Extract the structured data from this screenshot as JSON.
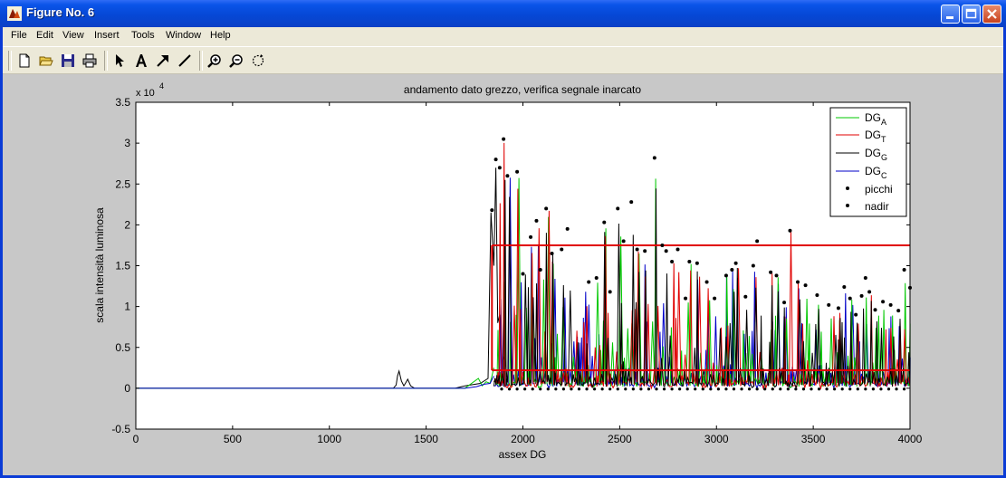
{
  "window": {
    "title": "Figure No. 6"
  },
  "menu": [
    "File",
    "Edit",
    "View",
    "Insert",
    "Tools",
    "Window",
    "Help"
  ],
  "toolbar": {
    "icons": [
      "new-file-icon",
      "open-folder-icon",
      "save-icon",
      "print-icon",
      "arrow-select-icon",
      "text-tool-icon",
      "arrow-tool-icon",
      "line-tool-icon",
      "zoom-in-icon",
      "zoom-out-icon",
      "rotate-icon"
    ]
  },
  "colors": {
    "A": "#00c800",
    "T": "#e00000",
    "G": "#000000",
    "C": "#0000c8",
    "threshold": "#e00000"
  },
  "chart_data": {
    "type": "line",
    "title": "andamento dato grezzo, verifica segnale inarcato",
    "xlabel": "assex DG",
    "ylabel": "scala intensità luminosa",
    "y_exponent": "x 10",
    "y_exponent_power": "4",
    "xlim": [
      0,
      4000
    ],
    "ylim": [
      -5000,
      35000
    ],
    "xticks": [
      0,
      500,
      1000,
      1500,
      2000,
      2500,
      3000,
      3500,
      4000
    ],
    "xtick_labels": [
      "0",
      "500",
      "1000",
      "1500",
      "2000",
      "2500",
      "3000",
      "3500",
      "4000"
    ],
    "yticks": [
      -5000,
      0,
      5000,
      10000,
      15000,
      20000,
      25000,
      30000,
      35000
    ],
    "ytick_labels": [
      "-0.5",
      "0",
      "0.5",
      "1",
      "1.5",
      "2",
      "2.5",
      "3",
      "3.5"
    ],
    "legend_placement": "top-right",
    "legend": [
      {
        "key": "A",
        "base": "DG",
        "sub": "A",
        "style": "line"
      },
      {
        "key": "T",
        "base": "DG",
        "sub": "T",
        "style": "line"
      },
      {
        "key": "G",
        "base": "DG",
        "sub": "G",
        "style": "line"
      },
      {
        "key": "C",
        "base": "DG",
        "sub": "C",
        "style": "line"
      },
      {
        "key": "picchi",
        "label": "picchi",
        "style": "marker"
      },
      {
        "key": "nadir",
        "label": "nadir",
        "style": "marker"
      }
    ],
    "thresholds": [
      {
        "y": 17500,
        "x": [
          1840,
          4000
        ]
      },
      {
        "y": 2200,
        "x": [
          1840,
          4000
        ]
      }
    ],
    "series": [
      {
        "key": "G",
        "name": "DG_G",
        "x": [
          0,
          1330,
          1345,
          1352,
          1360,
          1372,
          1385,
          1395,
          1405,
          1420,
          1440,
          1650,
          1700,
          1780,
          1820,
          1835,
          1850,
          1860,
          1870,
          1880,
          1890,
          1905,
          1920
        ],
        "y": [
          0,
          0,
          400,
          1500,
          2100,
          900,
          300,
          700,
          1100,
          300,
          0,
          0,
          300,
          600,
          1200,
          21500,
          15000,
          27000,
          8000,
          9000,
          3000,
          4000,
          1000
        ]
      },
      {
        "key": "A",
        "name": "DG_A",
        "x": [
          0,
          1700,
          1770,
          1790,
          1810,
          1830,
          1840,
          1850
        ],
        "y": [
          0,
          0,
          1200,
          300,
          800,
          600,
          1500,
          2500
        ]
      },
      {
        "key": "C",
        "name": "DG_C",
        "x": [
          0,
          1700,
          1760,
          1800,
          1830,
          1850
        ],
        "y": [
          0,
          0,
          200,
          500,
          600,
          1500
        ]
      }
    ],
    "burst_start": 1850,
    "burst_end": 4000,
    "peaks": {
      "x": [
        1840,
        1860,
        1880,
        1900,
        1920,
        1970,
        2000,
        2040,
        2070,
        2090,
        2120,
        2150,
        2200,
        2230,
        2340,
        2380,
        2420,
        2450,
        2490,
        2520,
        2560,
        2590,
        2630,
        2680,
        2720,
        2740,
        2770,
        2800,
        2840,
        2860,
        2900,
        2950,
        2990,
        3050,
        3080,
        3100,
        3150,
        3190,
        3210,
        3280,
        3310,
        3350,
        3380,
        3420,
        3460,
        3520,
        3580,
        3630,
        3660,
        3690,
        3720,
        3750,
        3770,
        3790,
        3820,
        3860,
        3900,
        3940,
        3970,
        4000
      ],
      "y": [
        21800,
        28000,
        27000,
        30500,
        26000,
        26500,
        14000,
        18500,
        20500,
        14500,
        22000,
        16500,
        17000,
        19500,
        13000,
        13500,
        20300,
        11800,
        22000,
        18000,
        22800,
        17000,
        16800,
        28200,
        17500,
        16800,
        15500,
        17000,
        11000,
        15500,
        15300,
        13000,
        11000,
        13800,
        14500,
        15300,
        11200,
        15000,
        18000,
        14200,
        13800,
        10500,
        19300,
        13000,
        12600,
        11400,
        10200,
        9800,
        12400,
        11000,
        9000,
        11300,
        13500,
        11800,
        9600,
        10600,
        10200,
        9500,
        14500,
        12300
      ]
    },
    "nadir_x_step": 40,
    "nadir_y": -100
  }
}
